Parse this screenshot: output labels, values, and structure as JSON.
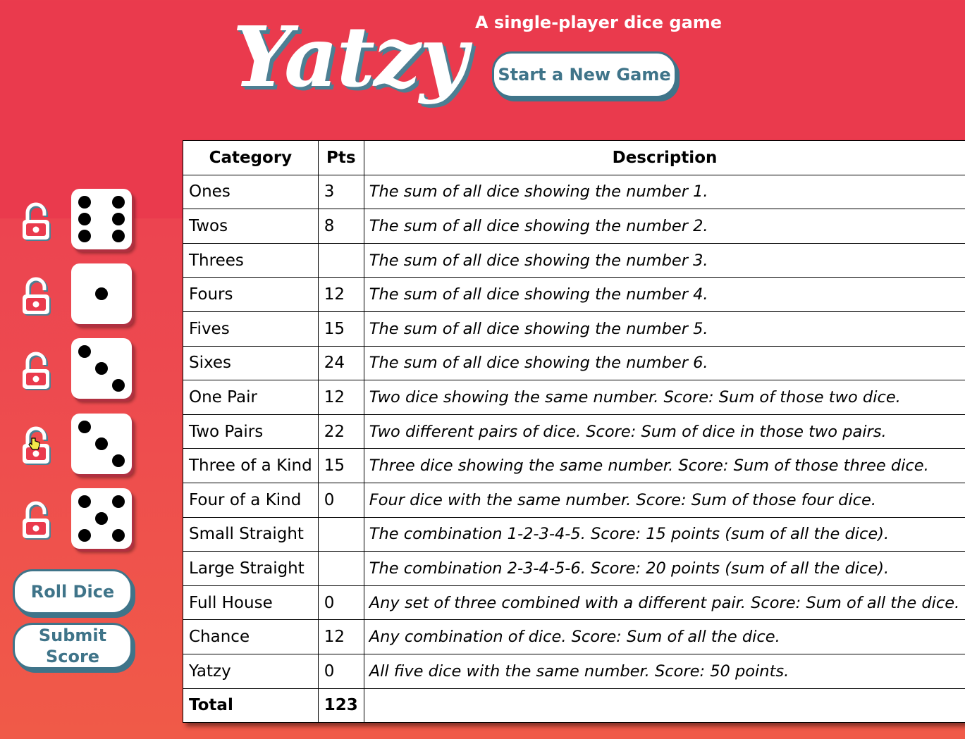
{
  "header": {
    "logo_text": "Yatzy",
    "tagline": "A single-player dice game",
    "new_game_label": "Start a New Game"
  },
  "dice": [
    {
      "value": 6,
      "locked": false
    },
    {
      "value": 1,
      "locked": false
    },
    {
      "value": 3,
      "locked": false
    },
    {
      "value": 3,
      "locked": false
    },
    {
      "value": 5,
      "locked": false
    }
  ],
  "controls": {
    "roll_label": "Roll Dice",
    "submit_line1": "Submit",
    "submit_line2": "Score"
  },
  "table": {
    "headers": {
      "category": "Category",
      "pts": "Pts",
      "description": "Description"
    },
    "rows": [
      {
        "category": "Ones",
        "pts": "3",
        "description": "The sum of all dice showing the number 1."
      },
      {
        "category": "Twos",
        "pts": "8",
        "description": "The sum of all dice showing the number 2."
      },
      {
        "category": "Threes",
        "pts": "",
        "description": "The sum of all dice showing the number 3."
      },
      {
        "category": "Fours",
        "pts": "12",
        "description": "The sum of all dice showing the number 4."
      },
      {
        "category": "Fives",
        "pts": "15",
        "description": "The sum of all dice showing the number 5."
      },
      {
        "category": "Sixes",
        "pts": "24",
        "description": "The sum of all dice showing the number 6."
      },
      {
        "category": "One Pair",
        "pts": "12",
        "description": "Two dice showing the same number. Score: Sum of those two dice."
      },
      {
        "category": "Two Pairs",
        "pts": "22",
        "description": "Two different pairs of dice. Score: Sum of dice in those two pairs."
      },
      {
        "category": "Three of a Kind",
        "pts": "15",
        "description": "Three dice showing the same number. Score: Sum of those three dice."
      },
      {
        "category": "Four of a Kind",
        "pts": "0",
        "description": "Four dice with the same number. Score: Sum of those four dice."
      },
      {
        "category": "Small Straight",
        "pts": "",
        "description": "The combination 1-2-3-4-5. Score: 15 points (sum of all the dice)."
      },
      {
        "category": "Large Straight",
        "pts": "",
        "description": "The combination 2-3-4-5-6. Score: 20 points (sum of all the dice)."
      },
      {
        "category": "Full House",
        "pts": "0",
        "description": "Any set of three combined with a different pair. Score: Sum of all the dice."
      },
      {
        "category": "Chance",
        "pts": "12",
        "description": "Any combination of dice. Score: Sum of all the dice."
      },
      {
        "category": "Yatzy",
        "pts": "0",
        "description": "All five dice with the same number. Score: 50 points."
      }
    ],
    "total": {
      "label": "Total",
      "pts": "123"
    }
  },
  "colors": {
    "background_top": "#ea3a4d",
    "background_bottom": "#f05a48",
    "accent": "#3f7489",
    "die_face": "#ffffff"
  },
  "icons": {
    "lock": "unlocked-padlock-icon",
    "cursor": "hand-pointer-icon"
  }
}
